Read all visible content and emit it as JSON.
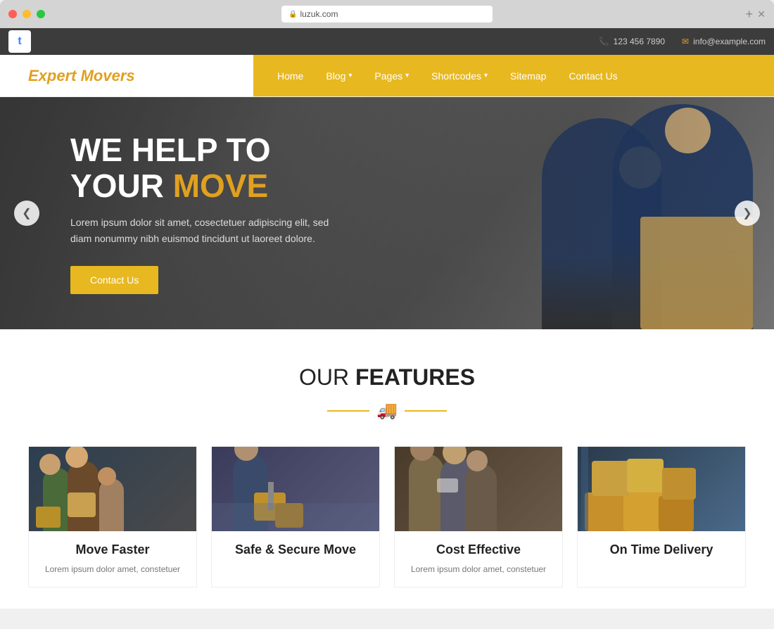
{
  "browser": {
    "url": "luzuk.com",
    "logo_letter": "t"
  },
  "topbar": {
    "phone_icon": "📞",
    "phone": "123 456 7890",
    "email_icon": "✉",
    "email": "info@example.com"
  },
  "header": {
    "site_title": "Expert Movers",
    "nav_items": [
      {
        "label": "Home",
        "has_dropdown": false
      },
      {
        "label": "Blog",
        "has_dropdown": true
      },
      {
        "label": "Pages",
        "has_dropdown": true
      },
      {
        "label": "Shortcodes",
        "has_dropdown": true
      },
      {
        "label": "Sitemap",
        "has_dropdown": false
      },
      {
        "label": "Contact Us",
        "has_dropdown": false
      }
    ]
  },
  "hero": {
    "title_line1": "WE HELP TO",
    "title_line2_normal": "YOUR ",
    "title_line2_highlight": "MOVE",
    "description": "Lorem ipsum dolor sit amet, cosectetuer adipiscing elit, sed diam nonummy nibh euismod tincidunt ut laoreet dolore.",
    "cta_label": "Contact Us",
    "arrow_left": "❮",
    "arrow_right": "❯"
  },
  "features": {
    "section_title_normal": "OUR ",
    "section_title_bold": "FEATURES",
    "truck_icon": "🚚",
    "cards": [
      {
        "title": "Move Faster",
        "description": "Lorem ipsum dolor amet, constetuer"
      },
      {
        "title": "Safe & Secure Move",
        "description": ""
      },
      {
        "title": "Cost Effective",
        "description": "Lorem ipsum dolor amet, constetuer"
      },
      {
        "title": "On Time Delivery",
        "description": ""
      }
    ]
  }
}
